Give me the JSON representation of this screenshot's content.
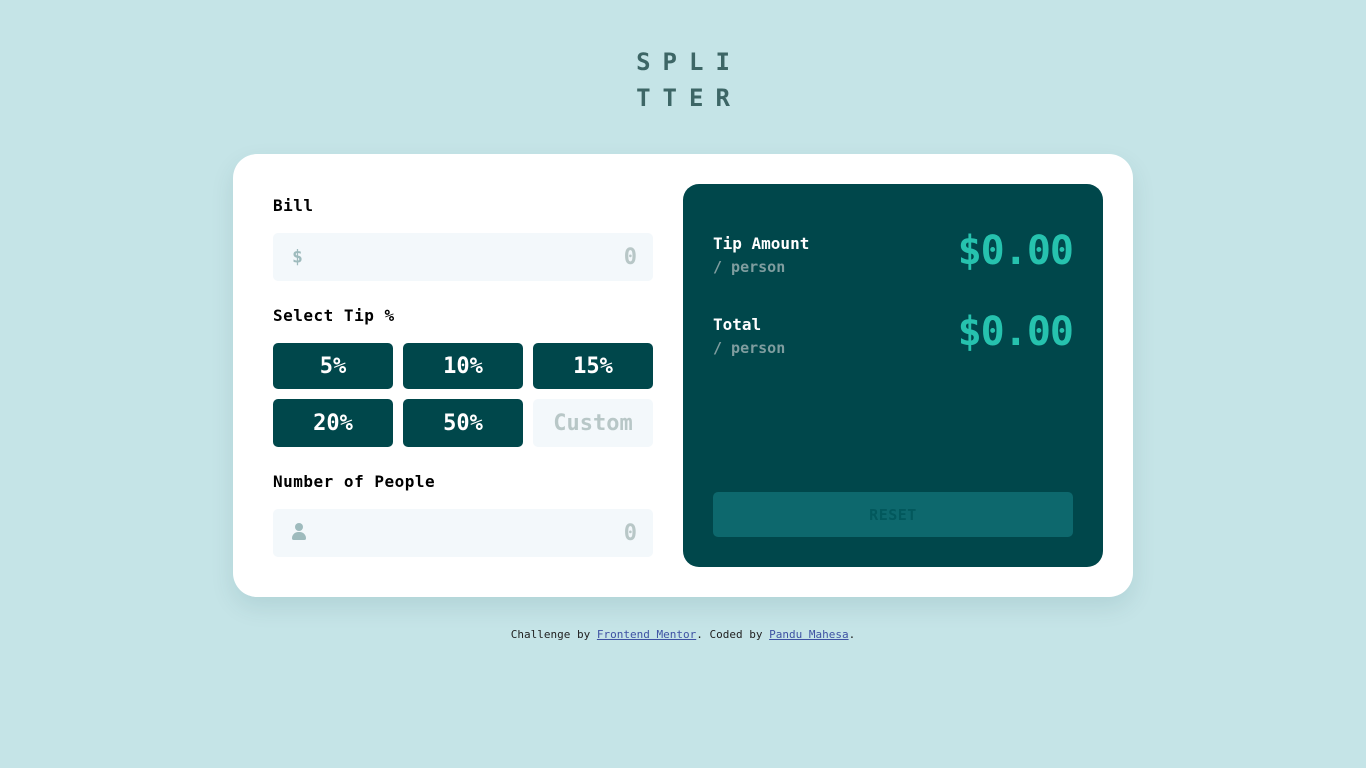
{
  "logo": {
    "line1": "SPLI",
    "line2": "TTER"
  },
  "bill": {
    "label": "Bill",
    "currency_symbol": "$",
    "placeholder": "0"
  },
  "tip": {
    "label": "Select Tip %",
    "options": [
      "5%",
      "10%",
      "15%",
      "20%",
      "50%"
    ],
    "custom_placeholder": "Custom"
  },
  "people": {
    "label": "Number of People",
    "placeholder": "0"
  },
  "results": {
    "tip_amount": {
      "title": "Tip Amount",
      "sub": "/ person",
      "value": "$0.00"
    },
    "total": {
      "title": "Total",
      "sub": "/ person",
      "value": "$0.00"
    },
    "reset_label": "RESET"
  },
  "footer": {
    "prefix": "Challenge by ",
    "link1": "Frontend Mentor",
    "middle": ". Coded by ",
    "link2": "Pandu Mahesa",
    "suffix": "."
  },
  "colors": {
    "background": "#c5e4e7",
    "dark_cyan": "#00474b",
    "strong_cyan": "#26c2ae",
    "reset_bg": "#0d686d"
  }
}
